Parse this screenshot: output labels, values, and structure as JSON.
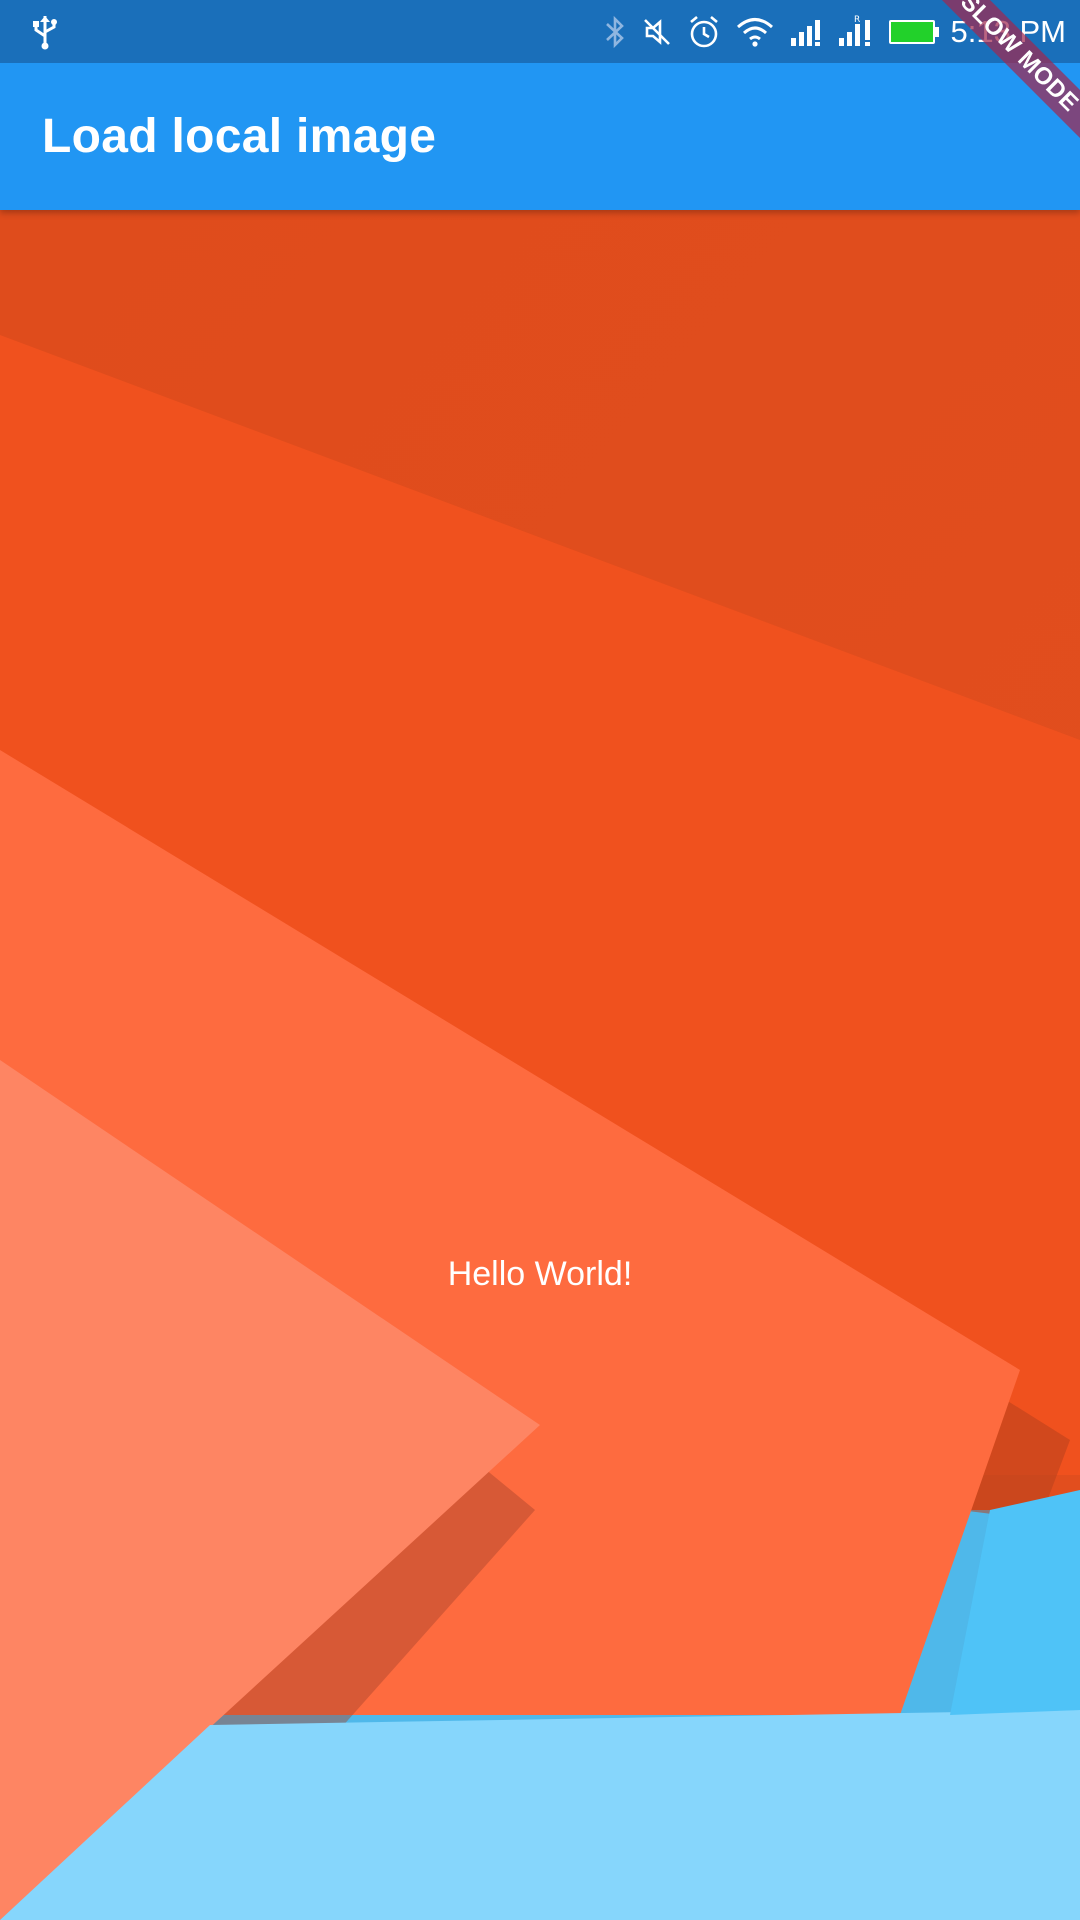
{
  "status_bar": {
    "time": "5:13 PM",
    "icons": [
      "usb-icon",
      "bluetooth-icon",
      "mute-icon",
      "alarm-icon",
      "wifi-icon",
      "signal-icon",
      "signal-roaming-icon",
      "battery-icon"
    ],
    "battery_color": "#22d12a"
  },
  "app_bar": {
    "title": "Load local image",
    "color": "#2196f3"
  },
  "body": {
    "text": "Hello World!"
  },
  "debug_banner": {
    "label": "SLOW MODE"
  }
}
